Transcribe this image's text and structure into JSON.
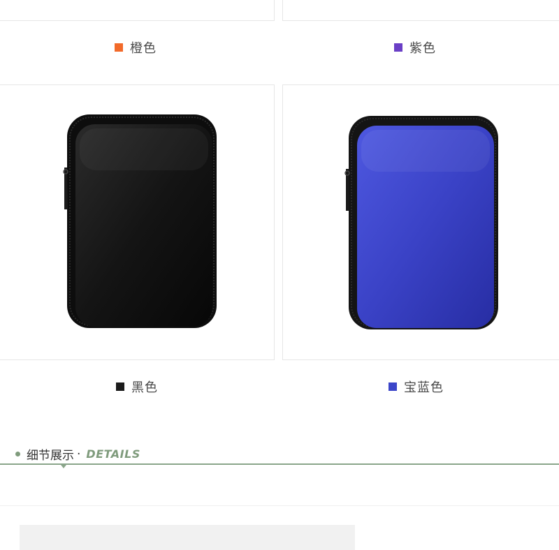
{
  "colors": {
    "orange": "#f26a2a",
    "purple": "#6a3fc6",
    "black": "#1b1b1b",
    "royal_blue": "#3b45c9",
    "accent_green": "#7f9b7c"
  },
  "variants": [
    {
      "label": "橙色",
      "swatch_color": "#f26a2a"
    },
    {
      "label": "紫色",
      "swatch_color": "#6a3fc6"
    },
    {
      "label": "黑色",
      "swatch_color": "#1b1b1b"
    },
    {
      "label": "宝蓝色",
      "swatch_color": "#3b45c9"
    }
  ],
  "products": [
    {
      "name": "black-case-image",
      "case_color": "#151515"
    },
    {
      "name": "blue-case-image",
      "case_color": "#3c44c8"
    }
  ],
  "section": {
    "title_cn": "细节展示",
    "separator": "·",
    "title_en": "DETAILS"
  }
}
